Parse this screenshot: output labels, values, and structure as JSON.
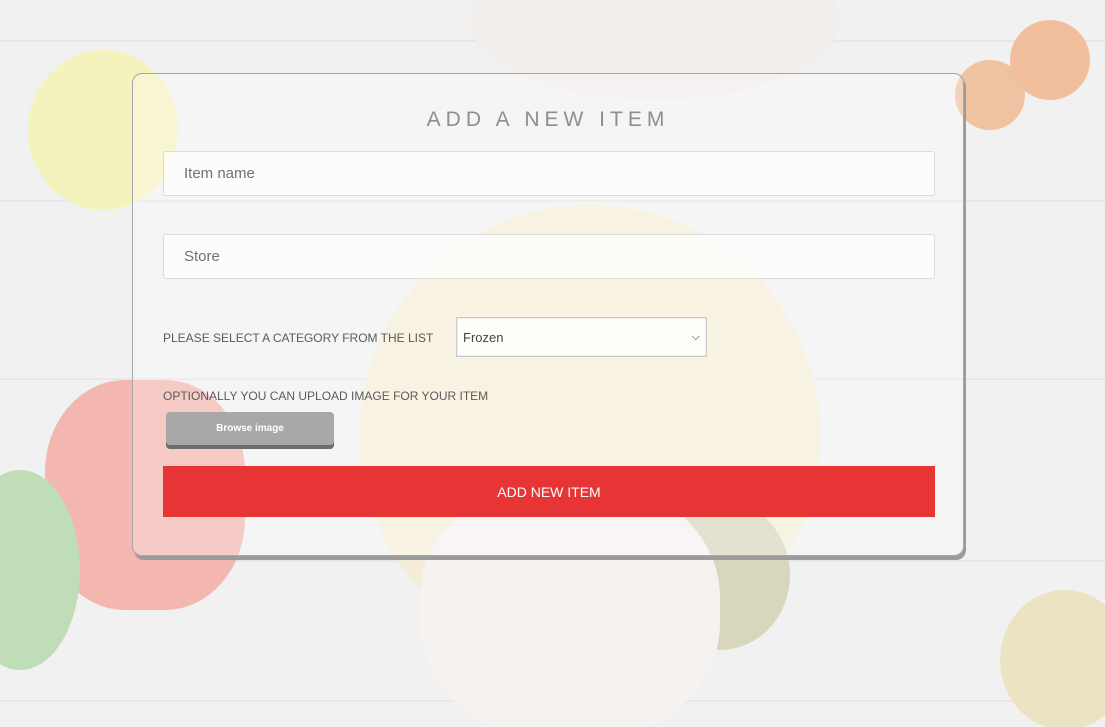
{
  "form": {
    "title": "ADD A NEW ITEM",
    "item_name_placeholder": "Item name",
    "store_placeholder": "Store",
    "category_label": "PLEASE SELECT A CATEGORY FROM THE LIST",
    "category_selected": "Frozen",
    "upload_label": "OPTIONALLY YOU CAN UPLOAD IMAGE FOR YOUR ITEM",
    "browse_label": "Browse image",
    "submit_label": "ADD NEW ITEM"
  },
  "icons": {
    "select_arrow": "chevron-down-icon"
  },
  "colors": {
    "submit_bg": "#e73535",
    "browse_bg": "#a9a7a7",
    "title_text": "#8e8e8e"
  }
}
